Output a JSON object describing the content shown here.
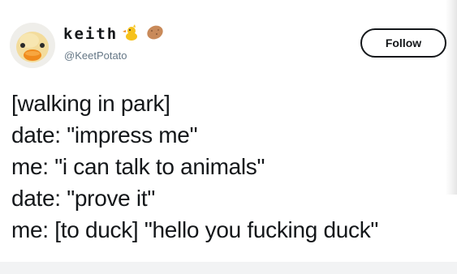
{
  "user": {
    "display_name": "keith",
    "handle": "@KeetPotato",
    "avatar_icon": "duck-avatar-icon",
    "name_emojis": [
      "chick-emoji-icon",
      "potato-emoji-icon"
    ]
  },
  "follow_button": {
    "label": "Follow"
  },
  "tweet": {
    "lines": [
      "[walking in park]",
      "date: \"impress me\"",
      "me: \"i can talk to animals\"",
      "date: \"prove it\"",
      "me: [to duck] \"hello you fucking duck\""
    ]
  },
  "colors": {
    "text": "#14171a",
    "secondary_text": "#657786",
    "background": "#ffffff",
    "duck_yellow": "#f4dfa0",
    "beak_orange": "#f08a1c"
  }
}
